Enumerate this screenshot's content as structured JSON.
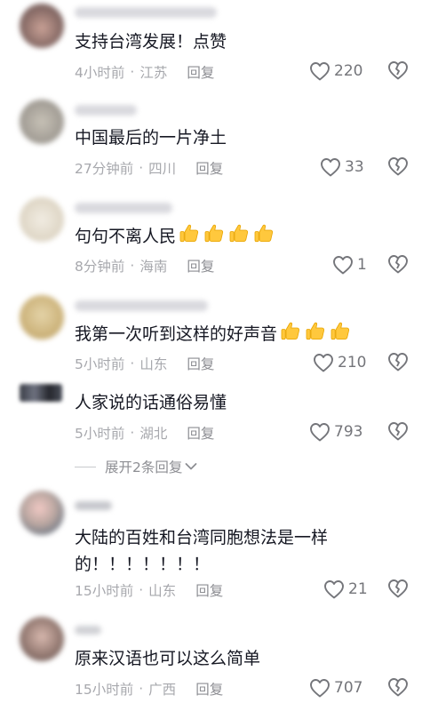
{
  "comments": [
    {
      "text": "支持台湾发展！点赞",
      "time": "4小时前",
      "location": "江苏",
      "reply": "回复",
      "likes": "220",
      "thumbs": 0
    },
    {
      "text": "中国最后的一片净土",
      "time": "27分钟前",
      "location": "四川",
      "reply": "回复",
      "likes": "33",
      "thumbs": 0
    },
    {
      "text": "句句不离人民",
      "time": "8分钟前",
      "location": "海南",
      "reply": "回复",
      "likes": "1",
      "thumbs": 4
    },
    {
      "text": "我第一次听到这样的好声音",
      "time": "5小时前",
      "location": "山东",
      "reply": "回复",
      "likes": "210",
      "thumbs": 3
    },
    {
      "text": "人家说的话通俗易懂",
      "time": "5小时前",
      "location": "湖北",
      "reply": "回复",
      "likes": "793",
      "thumbs": 0
    },
    {
      "text": "大陆的百姓和台湾同胞想法是一样\n的！！！！！！！",
      "time": "15小时前",
      "location": "山东",
      "reply": "回复",
      "likes": "21",
      "thumbs": 0
    },
    {
      "text": "原来汉语也可以这么简单",
      "time": "15小时前",
      "location": "广西",
      "reply": "回复",
      "likes": "707",
      "thumbs": 0
    }
  ],
  "expand_replies": "展开2条回复",
  "icons": {
    "like": "heart-outline-icon",
    "dislike": "broken-heart-icon",
    "thumbs_up": "thumbs-up-emoji-icon",
    "expand": "chevron-down-icon"
  },
  "colors": {
    "text": "#161823",
    "meta": "#a7a8ad",
    "icon": "#74757a",
    "thumb": "#ffc83d"
  }
}
